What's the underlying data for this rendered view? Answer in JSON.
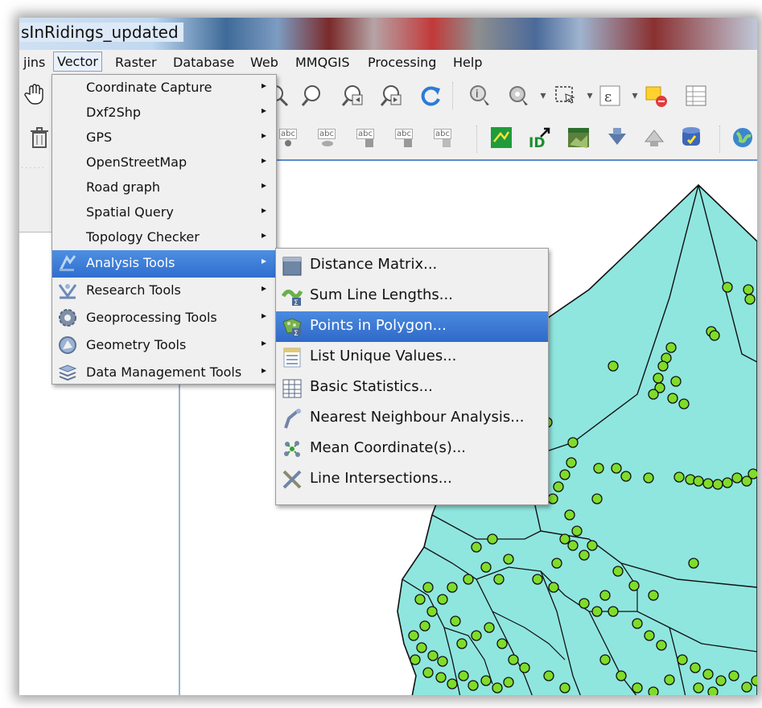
{
  "window": {
    "title": "sInRidings_updated"
  },
  "menubar": {
    "items": [
      {
        "label": "jins"
      },
      {
        "label": "Vector"
      },
      {
        "label": "Raster"
      },
      {
        "label": "Database"
      },
      {
        "label": "Web"
      },
      {
        "label": "MMQGIS"
      },
      {
        "label": "Processing"
      },
      {
        "label": "Help"
      }
    ]
  },
  "vector_menu": {
    "items": [
      {
        "label": "Coordinate Capture"
      },
      {
        "label": "Dxf2Shp"
      },
      {
        "label": "GPS"
      },
      {
        "label": "OpenStreetMap"
      },
      {
        "label": "Road graph"
      },
      {
        "label": "Spatial Query"
      },
      {
        "label": "Topology Checker"
      },
      {
        "label": "Analysis Tools"
      },
      {
        "label": "Research Tools"
      },
      {
        "label": "Geoprocessing Tools"
      },
      {
        "label": "Geometry Tools"
      },
      {
        "label": "Data Management Tools"
      }
    ],
    "submenu_arrow": "▸"
  },
  "analysis_submenu": {
    "items": [
      {
        "label": "Distance Matrix...",
        "icon": "distance-matrix-icon"
      },
      {
        "label": "Sum Line Lengths...",
        "icon": "sum-line-lengths-icon"
      },
      {
        "label": "Points in Polygon...",
        "icon": "points-in-polygon-icon"
      },
      {
        "label": "List Unique Values...",
        "icon": "list-unique-values-icon"
      },
      {
        "label": "Basic Statistics...",
        "icon": "basic-statistics-icon"
      },
      {
        "label": "Nearest Neighbour Analysis...",
        "icon": "nearest-neighbour-icon"
      },
      {
        "label": "Mean Coordinate(s)...",
        "icon": "mean-coordinate-icon"
      },
      {
        "label": "Line Intersections...",
        "icon": "line-intersections-icon"
      }
    ]
  },
  "toolbar": {
    "label_icons": [
      "abc",
      "abc",
      "abc",
      "abc",
      "abc"
    ]
  },
  "colors": {
    "polygon_fill": "#8fe6df",
    "point_fill": "#7fdc2a",
    "highlight": "#3a78d6"
  }
}
